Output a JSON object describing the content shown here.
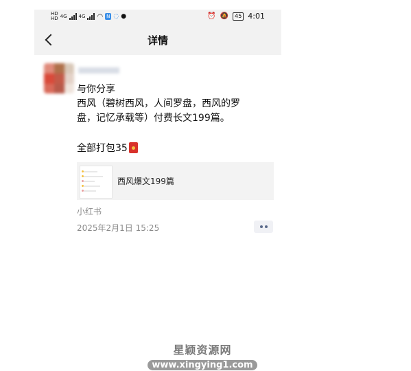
{
  "statusbar": {
    "hd1": "HD",
    "hd2": "HD",
    "net1": "4G",
    "net2": "4G",
    "nfc": "N",
    "battery": "45",
    "time": "4:01"
  },
  "navbar": {
    "title": "详情"
  },
  "post": {
    "line1": "与你分享",
    "line2": "西风（碧树西风，人间罗盘，西风的罗",
    "line3": "盘，记忆承载等）付费长文199篇。",
    "pack_text": "全部打包35",
    "link_title": "西风爆文199篇",
    "source": "小红书",
    "time": "2025年2月1日 15:25"
  },
  "watermark": {
    "cn": "星颖资源网",
    "url": "www.xingying1.com"
  },
  "icons": [
    "back-icon",
    "red-packet-icon",
    "more-icon",
    "wifi-icon",
    "alarm-icon",
    "mute-icon"
  ]
}
